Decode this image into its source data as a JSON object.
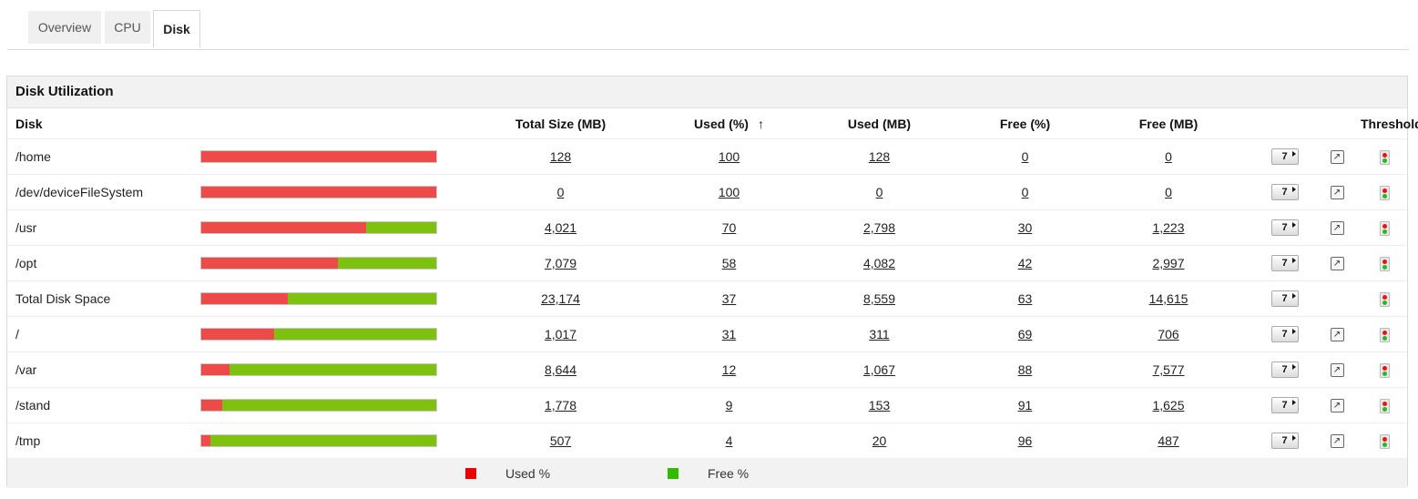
{
  "tabs": [
    {
      "label": "Overview"
    },
    {
      "label": "CPU"
    },
    {
      "label": "Disk"
    }
  ],
  "panel": {
    "title": "Disk Utilization",
    "columns": {
      "disk": "Disk",
      "total": "Total Size (MB)",
      "used_pct": "Used (%)",
      "sort_arrow": "↑",
      "used_mb": "Used (MB)",
      "free_pct": "Free (%)",
      "free_mb": "Free (MB)",
      "threshold": "Threshold"
    },
    "rows": [
      {
        "name": "/home",
        "total": "128",
        "used_pct": "100",
        "used_mb": "128",
        "free_pct": "0",
        "free_mb": "0",
        "used_fraction": 1.0,
        "has_link": true
      },
      {
        "name": "/dev/deviceFileSystem",
        "total": "0",
        "used_pct": "100",
        "used_mb": "0",
        "free_pct": "0",
        "free_mb": "0",
        "used_fraction": 1.0,
        "has_link": true
      },
      {
        "name": "/usr",
        "total": "4,021",
        "used_pct": "70",
        "used_mb": "2,798",
        "free_pct": "30",
        "free_mb": "1,223",
        "used_fraction": 0.7,
        "has_link": true
      },
      {
        "name": "/opt",
        "total": "7,079",
        "used_pct": "58",
        "used_mb": "4,082",
        "free_pct": "42",
        "free_mb": "2,997",
        "used_fraction": 0.58,
        "has_link": true
      },
      {
        "name": "Total Disk Space",
        "total": "23,174",
        "used_pct": "37",
        "used_mb": "8,559",
        "free_pct": "63",
        "free_mb": "14,615",
        "used_fraction": 0.37,
        "has_link": false
      },
      {
        "name": "/",
        "total": "1,017",
        "used_pct": "31",
        "used_mb": "311",
        "free_pct": "69",
        "free_mb": "706",
        "used_fraction": 0.31,
        "has_link": true
      },
      {
        "name": "/var",
        "total": "8,644",
        "used_pct": "12",
        "used_mb": "1,067",
        "free_pct": "88",
        "free_mb": "7,577",
        "used_fraction": 0.12,
        "has_link": true
      },
      {
        "name": "/stand",
        "total": "1,778",
        "used_pct": "9",
        "used_mb": "153",
        "free_pct": "91",
        "free_mb": "1,625",
        "used_fraction": 0.09,
        "has_link": true
      },
      {
        "name": "/tmp",
        "total": "507",
        "used_pct": "4",
        "used_mb": "20",
        "free_pct": "96",
        "free_mb": "487",
        "used_fraction": 0.04,
        "has_link": true
      }
    ],
    "report_icon_label": "7",
    "legend": {
      "used_label": "Used %",
      "free_label": "Free %",
      "used_color": "#ee0000",
      "free_color": "#33bb00"
    }
  }
}
